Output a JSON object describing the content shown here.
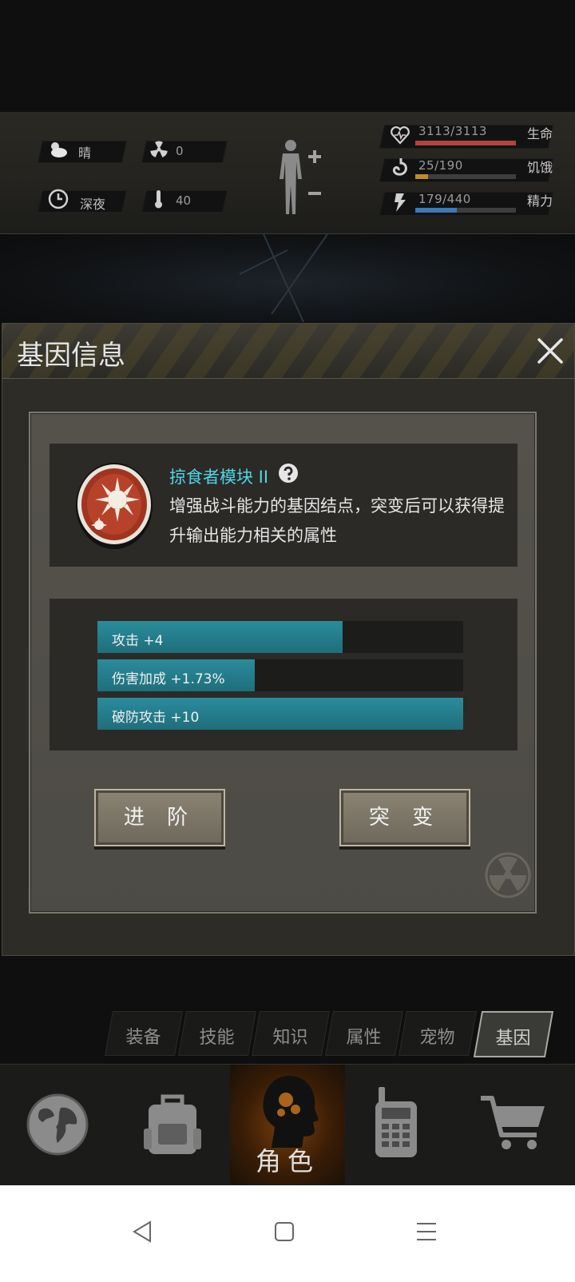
{
  "status": {
    "weather": "晴",
    "radiation": "0",
    "time_of_day": "深夜",
    "temperature": "40",
    "icons": [
      "weather-cloud-icon",
      "radiation-icon",
      "clock-icon",
      "thermometer-icon",
      "body-figure-icon"
    ],
    "meters": [
      {
        "name": "生命",
        "value": "3113/3113",
        "fraction": 1.0,
        "color": "#b3433d",
        "icon": "heart-icon"
      },
      {
        "name": "饥饿",
        "value": "25/190",
        "fraction": 0.13,
        "color": "#c08a2d",
        "icon": "stomach-icon"
      },
      {
        "name": "精力",
        "value": "179/440",
        "fraction": 0.41,
        "color": "#3b79b8",
        "icon": "lightning-icon"
      }
    ]
  },
  "dialog": {
    "title": "基因信息",
    "gene": {
      "name": "掠食者模块 II",
      "description": "增强战斗能力的基因结点，突变后可以获得提升输出能力相关的属性"
    },
    "stats": [
      {
        "label": "攻击 +4",
        "fill": 0.67
      },
      {
        "label": "伤害加成 +1.73%",
        "fill": 0.43
      },
      {
        "label": "破防攻击 +10",
        "fill": 1.0
      }
    ],
    "buttons": {
      "advance": "进 阶",
      "mutate": "突 变"
    }
  },
  "tabs": [
    {
      "label": "装备",
      "active": false
    },
    {
      "label": "技能",
      "active": false
    },
    {
      "label": "知识",
      "active": false
    },
    {
      "label": "属性",
      "active": false
    },
    {
      "label": "宠物",
      "active": false
    },
    {
      "label": "基因",
      "active": true
    }
  ],
  "nav": [
    {
      "icon": "globe-icon",
      "label": ""
    },
    {
      "icon": "backpack-icon",
      "label": ""
    },
    {
      "icon": "character-head-icon",
      "label": "角色",
      "active": true
    },
    {
      "icon": "walkie-talkie-icon",
      "label": ""
    },
    {
      "icon": "shopping-cart-icon",
      "label": ""
    }
  ],
  "colors": {
    "accent_cyan": "#4fd6e4",
    "bar_teal": "#1f6e7b"
  }
}
